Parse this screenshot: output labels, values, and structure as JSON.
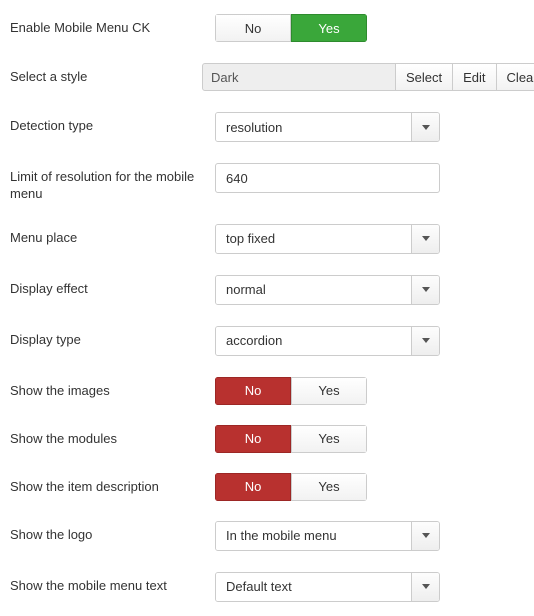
{
  "toggle_no": "No",
  "toggle_yes": "Yes",
  "rows": {
    "enable": {
      "label": "Enable Mobile Menu CK"
    },
    "style": {
      "label": "Select a style",
      "value": "Dark",
      "btn_select": "Select",
      "btn_edit": "Edit",
      "btn_clear": "Clear"
    },
    "detection": {
      "label": "Detection type",
      "value": "resolution"
    },
    "limit": {
      "label": "Limit of resolution for the mobile menu",
      "value": "640"
    },
    "place": {
      "label": "Menu place",
      "value": "top fixed"
    },
    "effect": {
      "label": "Display effect",
      "value": "normal"
    },
    "dtype": {
      "label": "Display type",
      "value": "accordion"
    },
    "show_images": {
      "label": "Show the images"
    },
    "show_modules": {
      "label": "Show the modules"
    },
    "show_desc": {
      "label": "Show the item description"
    },
    "show_logo": {
      "label": "Show the logo",
      "value": "In the mobile menu"
    },
    "show_text": {
      "label": "Show the mobile menu text",
      "value": "Default text"
    }
  }
}
